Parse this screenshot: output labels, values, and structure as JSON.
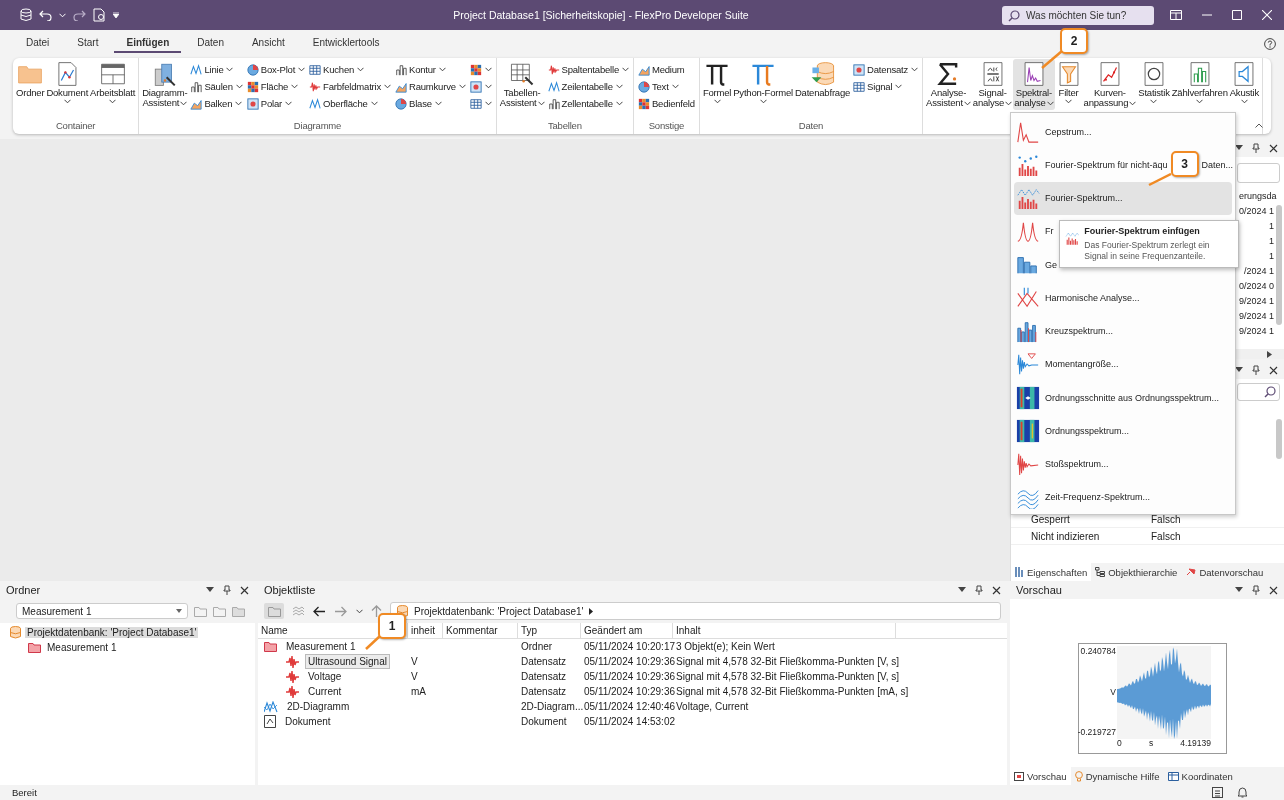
{
  "window": {
    "title": "Project Database1 [Sicherheitskopie] - FlexPro Developer Suite"
  },
  "search": {
    "placeholder": "Was möchten Sie tun?"
  },
  "ribbon_tabs": [
    {
      "label": "Datei",
      "selected": false
    },
    {
      "label": "Start",
      "selected": false
    },
    {
      "label": "Einfügen",
      "selected": true
    },
    {
      "label": "Daten",
      "selected": false
    },
    {
      "label": "Ansicht",
      "selected": false
    },
    {
      "label": "Entwicklertools",
      "selected": false
    }
  ],
  "ribbon_groups": [
    {
      "label": "Container",
      "items": [
        {
          "kind": "large",
          "label": [
            "Ordner"
          ],
          "dropdown": false,
          "expanded": false
        },
        {
          "kind": "large",
          "label": [
            "Dokument"
          ],
          "dropdown": true,
          "expanded": false
        },
        {
          "kind": "large",
          "label": [
            "Arbeitsblatt"
          ],
          "dropdown": true,
          "expanded": false
        }
      ]
    },
    {
      "label": "Diagramme",
      "items": [
        {
          "kind": "large",
          "label": [
            "Diagramm-",
            "Assistent"
          ],
          "dropdown": true,
          "expanded": false
        },
        {
          "kind": "stack",
          "buttons": [
            {
              "label": "Linie",
              "dropdown": true
            },
            {
              "label": "Säulen",
              "dropdown": true
            },
            {
              "label": "Balken",
              "dropdown": true
            }
          ]
        },
        {
          "kind": "stack",
          "buttons": [
            {
              "label": "Box-Plot",
              "dropdown": true
            },
            {
              "label": "Fläche",
              "dropdown": true
            },
            {
              "label": "Polar",
              "dropdown": true
            }
          ]
        },
        {
          "kind": "stack",
          "buttons": [
            {
              "label": "Kuchen",
              "dropdown": true
            },
            {
              "label": "Farbfeldmatrix",
              "dropdown": true
            },
            {
              "label": "Oberfläche",
              "dropdown": true
            }
          ]
        },
        {
          "kind": "stack",
          "buttons": [
            {
              "label": "Kontur",
              "dropdown": true
            },
            {
              "label": "Raumkurve",
              "dropdown": true
            },
            {
              "label": "Blase",
              "dropdown": true
            }
          ]
        },
        {
          "kind": "stack",
          "buttons": [
            {
              "dropdown": true
            },
            {
              "dropdown": true
            },
            {
              "dropdown": true
            }
          ]
        }
      ]
    },
    {
      "label": "Tabellen",
      "items": [
        {
          "kind": "large",
          "label": [
            "Tabellen-",
            "Assistent"
          ],
          "dropdown": true,
          "expanded": false
        },
        {
          "kind": "stack",
          "buttons": [
            {
              "label": "Spaltentabelle",
              "dropdown": true
            },
            {
              "label": "Zeilentabelle",
              "dropdown": true
            },
            {
              "label": "Zellentabelle",
              "dropdown": true
            }
          ]
        }
      ]
    },
    {
      "label": "Sonstige",
      "items": [
        {
          "kind": "stack",
          "buttons": [
            {
              "label": "Medium",
              "dropdown": false
            },
            {
              "label": "Text",
              "dropdown": true
            },
            {
              "label": "Bedienfeld",
              "dropdown": false
            }
          ]
        }
      ]
    },
    {
      "label": "Daten",
      "items": [
        {
          "kind": "large",
          "label": [
            "Formel"
          ],
          "dropdown": true,
          "expanded": false
        },
        {
          "kind": "large",
          "label": [
            "Python-Formel"
          ],
          "dropdown": true,
          "expanded": false
        },
        {
          "kind": "large",
          "label": [
            "Datenabfrage"
          ],
          "dropdown": false,
          "expanded": false
        },
        {
          "kind": "stack",
          "buttons": [
            {
              "label": "Datensatz",
              "dropdown": true
            },
            {
              "label": "Signal",
              "dropdown": true
            }
          ]
        }
      ]
    },
    {
      "items": [
        {
          "kind": "large",
          "label": [
            "Analyse-",
            "Assistent"
          ],
          "dropdown": true,
          "expanded": false
        },
        {
          "kind": "large",
          "label": [
            "Signal-",
            "analyse"
          ],
          "dropdown": true,
          "expanded": false
        },
        {
          "kind": "large",
          "label": [
            "Spektral-",
            "analyse"
          ],
          "dropdown": true,
          "expanded": true
        },
        {
          "kind": "large",
          "label": [
            "Filter"
          ],
          "dropdown": true,
          "expanded": false
        },
        {
          "kind": "large",
          "label": [
            "Kurven-",
            "anpassung"
          ],
          "dropdown": true,
          "expanded": false
        },
        {
          "kind": "large",
          "label": [
            "Statistik"
          ],
          "dropdown": true,
          "expanded": false
        },
        {
          "kind": "large",
          "label": [
            "Zählverfahren"
          ],
          "dropdown": true,
          "expanded": false
        },
        {
          "kind": "large",
          "label": [
            "Akustik"
          ],
          "dropdown": true,
          "expanded": false
        }
      ]
    }
  ],
  "menu": {
    "items": [
      {
        "label": "Cepstrum...",
        "selected": false
      },
      {
        "label": "Fourier-Spektrum für nicht-äqu",
        "label_tail": "Daten...",
        "selected": false
      },
      {
        "label": "Fourier-Spektrum...",
        "selected": true
      },
      {
        "label": "Fr",
        "selected": false
      },
      {
        "label": "Ge",
        "selected": false
      },
      {
        "label": "Harmonische Analyse...",
        "selected": false
      },
      {
        "label": "Kreuzspektrum...",
        "selected": false
      },
      {
        "label": "Momentangröße...",
        "selected": false
      },
      {
        "label": "Ordnungsschnitte aus Ordnungsspektrum...",
        "selected": false
      },
      {
        "label": "Ordnungsspektrum...",
        "selected": false
      },
      {
        "label": "Stoßspektrum...",
        "selected": false
      },
      {
        "label": "Zeit-Frequenz-Spektrum...",
        "selected": false
      }
    ]
  },
  "tooltip": {
    "title": "Fourier-Spektrum einfügen",
    "text": "Das Fourier-Spektrum zerlegt ein Signal in seine Frequenzanteile."
  },
  "callouts": [
    {
      "number": "1"
    },
    {
      "number": "2"
    },
    {
      "number": "3"
    }
  ],
  "upper_panel": {
    "column_fragment": "erungsda",
    "cell_fragments": [
      "0/2024 1",
      "1",
      "1",
      "1",
      "/2024 1",
      "0/2024 0",
      "9/2024 1",
      "9/2024 1",
      "9/2024 1"
    ]
  },
  "properties_panel": {
    "rows": [
      {
        "name": "Gesperrt",
        "value": "Falsch"
      },
      {
        "name": "Nicht indizieren",
        "value": "Falsch"
      }
    ],
    "tabs": [
      {
        "label": "Eigenschaften",
        "selected": true
      },
      {
        "label": "Objekthierarchie",
        "selected": false
      },
      {
        "label": "Datenvorschau",
        "selected": false
      }
    ]
  },
  "folder_panel": {
    "title": "Ordner",
    "combo": "Measurement 1",
    "tree": [
      {
        "label": "Projektdatenbank: 'Project Database1'",
        "kind": "database",
        "selected": true,
        "children": [
          {
            "label": "Measurement 1",
            "kind": "folder",
            "selected": false
          }
        ]
      }
    ]
  },
  "object_list": {
    "title": "Objektliste",
    "path": "Projektdatenbank: 'Project Database1'",
    "columns": [
      "Name",
      "inheit",
      "Kommentar",
      "Typ",
      "Geändert am",
      "Inhalt"
    ],
    "rows": [
      {
        "kind": "folder",
        "name": "Measurement 1",
        "type": "Ordner",
        "modified": "05/11/2024 10:20:17",
        "content": "3 Objekt(e); Kein Wert",
        "selected": false,
        "children": [
          {
            "kind": "dataset",
            "name": "Ultrasound Signal",
            "unit": "V",
            "type": "Datensatz",
            "modified": "05/11/2024 10:29:36",
            "content": "Signal mit 4,578 32-Bit Fließkomma-Punkten [V, s]",
            "selected": true
          },
          {
            "kind": "dataset",
            "name": "Voltage",
            "unit": "V",
            "type": "Datensatz",
            "modified": "05/11/2024 10:29:36",
            "content": "Signal mit 4,578 32-Bit Fließkomma-Punkten [V, s]",
            "selected": false
          },
          {
            "kind": "dataset",
            "name": "Current",
            "unit": "mA",
            "type": "Datensatz",
            "modified": "05/11/2024 10:29:36",
            "content": "Signal mit 4,578 32-Bit Fließkomma-Punkten [mA, s]",
            "selected": false
          }
        ]
      },
      {
        "kind": "diagram",
        "name": "2D-Diagramm",
        "type": "2D-Diagram...",
        "modified": "05/11/2024 12:40:46",
        "content": "Voltage, Current",
        "selected": false
      },
      {
        "kind": "document",
        "name": "Dokument",
        "type": "Dokument",
        "modified": "05/11/2024 14:53:02",
        "selected": false
      }
    ]
  },
  "preview": {
    "title": "Vorschau",
    "y_max": "0.240784",
    "y_unit": "V",
    "y_min": "-0.219727",
    "x_min": "0",
    "x_unit": "s",
    "x_max": "4.19139",
    "tabs": [
      {
        "label": "Vorschau",
        "selected": true
      },
      {
        "label": "Dynamische Hilfe",
        "selected": false
      },
      {
        "label": "Koordinaten",
        "selected": false
      }
    ]
  },
  "status_bar": {
    "text": "Bereit"
  }
}
